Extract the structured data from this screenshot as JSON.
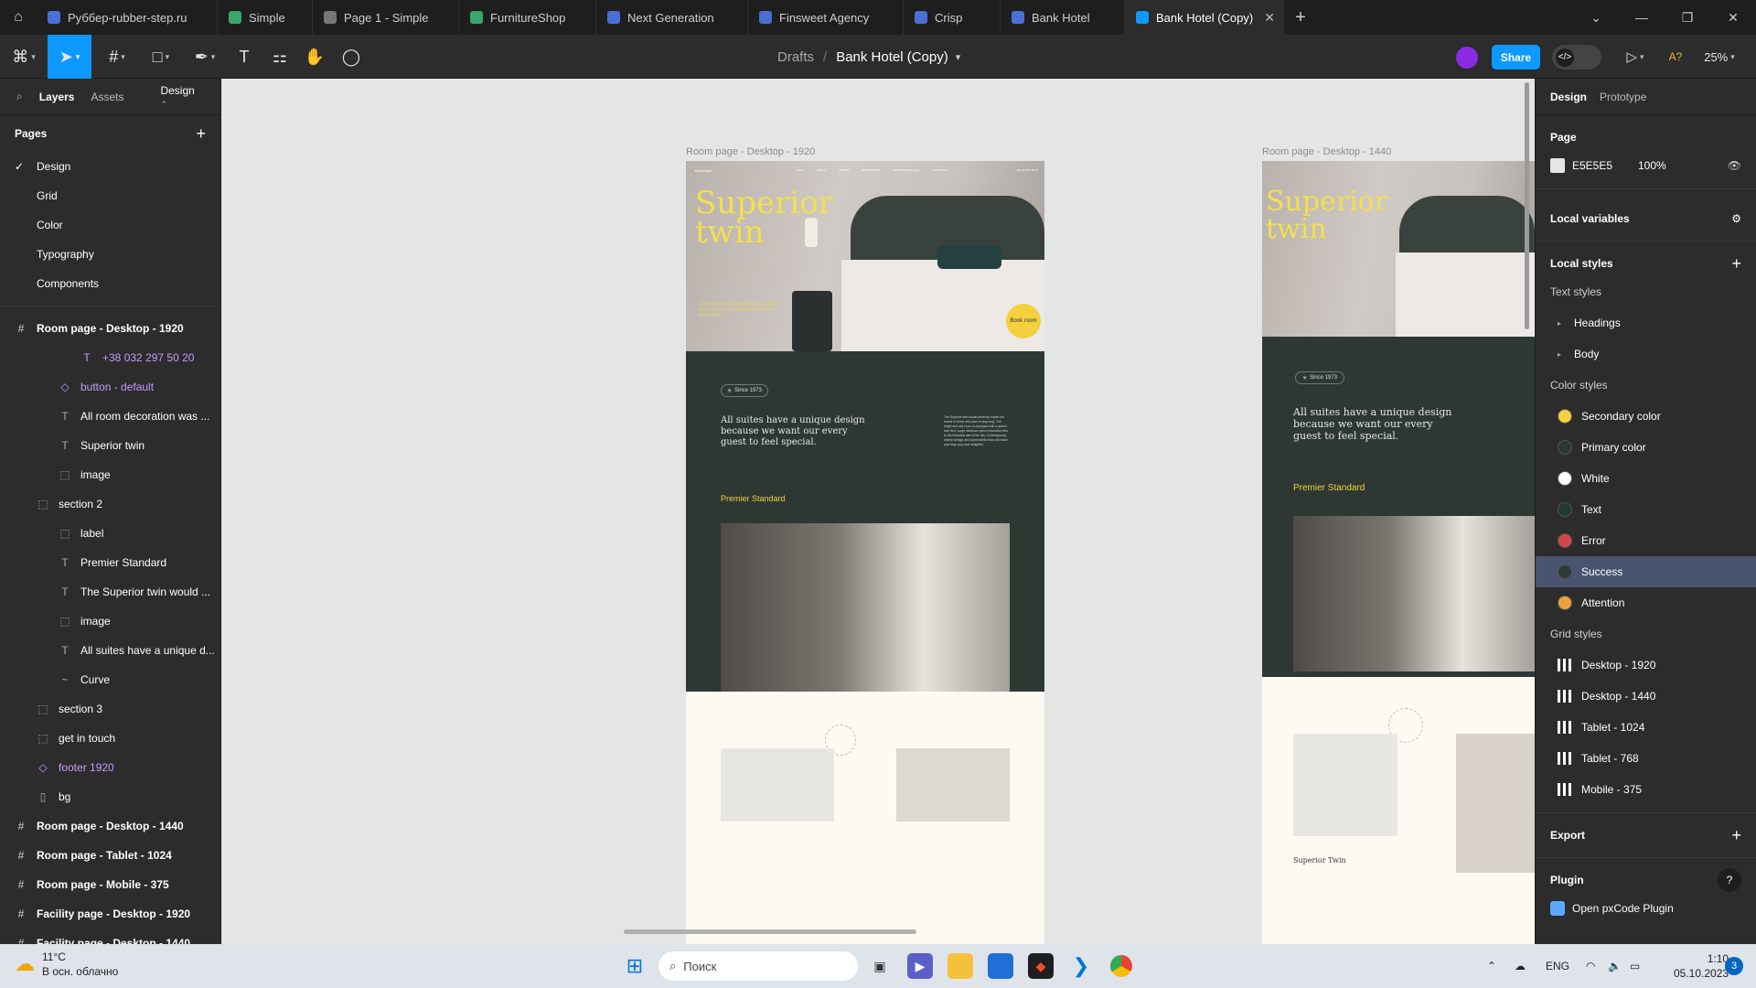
{
  "tabs": [
    {
      "label": "Руббер-rubber-step.ru",
      "color": "#4a6fd6"
    },
    {
      "label": "Simple",
      "color": "#3aa76d"
    },
    {
      "label": "Page 1 - Simple",
      "color": "#777777"
    },
    {
      "label": "FurnitureShop",
      "color": "#3aa76d"
    },
    {
      "label": "Next Generation",
      "color": "#4a6fd6"
    },
    {
      "label": "Finsweet Agency",
      "color": "#4a6fd6"
    },
    {
      "label": "Crisp",
      "color": "#4a6fd6"
    },
    {
      "label": "Bank Hotel",
      "color": "#4a6fd6"
    }
  ],
  "active_tab": {
    "label": "Bank Hotel (Copy)",
    "color": "#0d99ff"
  },
  "toolbar": {
    "breadcrumb_parent": "Drafts",
    "breadcrumb_sep": "/",
    "file_name": "Bank Hotel (Copy)",
    "share_label": "Share",
    "missing_fonts": "A?",
    "zoom": "25%"
  },
  "left_panel": {
    "tabs": [
      "Layers",
      "Assets"
    ],
    "page_dropdown": "Design",
    "pages_title": "Pages",
    "pages": [
      "Design",
      "Grid",
      "Color",
      "Typography",
      "Components"
    ],
    "current_page": "Design",
    "layers": [
      {
        "label": "Room page - Desktop - 1920",
        "icon": "#",
        "indent": 0,
        "kind": "frame"
      },
      {
        "label": "+38 032 297 50 20",
        "icon": "T",
        "indent": 3,
        "kind": "comp"
      },
      {
        "label": "button - default",
        "icon": "◇",
        "indent": 2,
        "kind": "comp"
      },
      {
        "label": "All room decoration was ...",
        "icon": "T",
        "indent": 2,
        "kind": "text"
      },
      {
        "label": "Superior twin",
        "icon": "T",
        "indent": 2,
        "kind": "text"
      },
      {
        "label": "image",
        "icon": "⬚",
        "indent": 2,
        "kind": "text"
      },
      {
        "label": "section 2",
        "icon": "⬚",
        "indent": 1,
        "kind": "text"
      },
      {
        "label": "label",
        "icon": "⬚",
        "indent": 2,
        "kind": "text"
      },
      {
        "label": "Premier Standard",
        "icon": "T",
        "indent": 2,
        "kind": "text"
      },
      {
        "label": "The Superior twin would ...",
        "icon": "T",
        "indent": 2,
        "kind": "text"
      },
      {
        "label": "image",
        "icon": "⬚",
        "indent": 2,
        "kind": "text"
      },
      {
        "label": "All suites have a unique d...",
        "icon": "T",
        "indent": 2,
        "kind": "text"
      },
      {
        "label": "Curve",
        "icon": "~",
        "indent": 2,
        "kind": "text"
      },
      {
        "label": "section 3",
        "icon": "⬚",
        "indent": 1,
        "kind": "text"
      },
      {
        "label": "get in touch",
        "icon": "⬚",
        "indent": 1,
        "kind": "text"
      },
      {
        "label": "footer 1920",
        "icon": "◇",
        "indent": 1,
        "kind": "comp"
      },
      {
        "label": "bg",
        "icon": "▯",
        "indent": 1,
        "kind": "text"
      },
      {
        "label": "Room page - Desktop - 1440",
        "icon": "#",
        "indent": 0,
        "kind": "frame"
      },
      {
        "label": "Room page - Tablet - 1024",
        "icon": "#",
        "indent": 0,
        "kind": "frame"
      },
      {
        "label": "Room page - Mobile - 375",
        "icon": "#",
        "indent": 0,
        "kind": "frame"
      },
      {
        "label": "Facility page - Desktop - 1920",
        "icon": "#",
        "indent": 0,
        "kind": "frame"
      },
      {
        "label": "Facility page - Desktop - 1440",
        "icon": "#",
        "indent": 0,
        "kind": "frame"
      }
    ]
  },
  "canvas": {
    "frame1": {
      "label": "Room page - Desktop - 1920",
      "logo": "BankHotel",
      "nav": [
        "HOME",
        "ABOUT",
        "ROOMS",
        "RESTAURANT",
        "CONFERENCE HALL",
        "CONTACTS"
      ],
      "phone": "+38 032 297 50 20",
      "hero_title": "Superior twin",
      "hero_caption": "ALL ROOM DECORATION WAS MADE WITH ECOLOGICAL AND NATURAL MATERIALS.",
      "book_label": "Book room",
      "since": "Since 1973",
      "quote": "All suites have a unique design because we want our every guest to feel special.",
      "body": "The Superior twin would perfectly match the needs of those who plan to stay long. The bright and airy room is equipped with a queen-size bed, Large windows open a beautiful view to the historical part of the city. Contemporary interior design and comfortable beds will make your stay cozy and delightful.",
      "premier": "Premier Standard"
    },
    "frame2": {
      "label": "Room page - Desktop - 1440",
      "since": "Since 1973",
      "quote": "All suites have a unique design because we want our every guest to feel special.",
      "premier": "Premier Standard",
      "card_title": "Superior Twin"
    }
  },
  "right_panel": {
    "tabs": [
      "Design",
      "Prototype"
    ],
    "page_title": "Page",
    "page_color": "E5E5E5",
    "page_opacity": "100%",
    "local_variables": "Local variables",
    "local_styles": "Local styles",
    "text_styles_title": "Text styles",
    "text_styles": [
      "Headings",
      "Body"
    ],
    "color_styles_title": "Color styles",
    "color_styles": [
      {
        "label": "Secondary color",
        "color": "#f4d03f"
      },
      {
        "label": "Primary color",
        "color": "#2d3833"
      },
      {
        "label": "White",
        "color": "#ffffff"
      },
      {
        "label": "Text",
        "color": "#1f3b34"
      },
      {
        "label": "Error",
        "color": "#d64545"
      },
      {
        "label": "Success",
        "color": "#2f3a36"
      },
      {
        "label": "Attention",
        "color": "#e8a33d"
      }
    ],
    "selected_color_style": "Success",
    "grid_styles_title": "Grid styles",
    "grid_styles": [
      "Desktop - 1920",
      "Desktop - 1440",
      "Tablet - 1024",
      "Tablet - 768",
      "Mobile - 375"
    ],
    "export": "Export",
    "plugin": "Plugin",
    "plugin_item": "Open pxCode Plugin"
  },
  "taskbar": {
    "temp": "11°C",
    "weather": "В осн. облачно",
    "search": "Поиск",
    "lang": "ENG",
    "time": "1:10",
    "date": "05.10.2023",
    "badge": "3"
  }
}
